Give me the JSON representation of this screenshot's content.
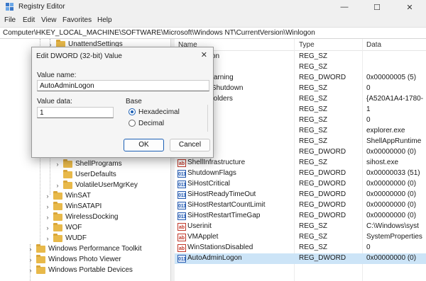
{
  "window": {
    "title": "Registry Editor",
    "minimize_glyph": "—",
    "maximize_glyph": "☐",
    "close_glyph": "✕"
  },
  "menu": [
    "File",
    "Edit",
    "View",
    "Favorites",
    "Help"
  ],
  "address": "Computer\\HKEY_LOCAL_MACHINE\\SOFTWARE\\Microsoft\\Windows NT\\CurrentVersion\\Winlogon",
  "tree": {
    "items": [
      {
        "label": "UnattendSettings"
      },
      {
        "label": "ShellPrograms"
      },
      {
        "label": "UserDefaults"
      },
      {
        "label": "VolatileUserMgrKey"
      },
      {
        "label": "WinSAT"
      },
      {
        "label": "WinSATAPI"
      },
      {
        "label": "WirelessDocking"
      },
      {
        "label": "WOF"
      },
      {
        "label": "WUDF"
      },
      {
        "label": "Windows Performance Toolkit"
      },
      {
        "label": "Windows Photo Viewer"
      },
      {
        "label": "Windows Portable Devices"
      }
    ]
  },
  "list": {
    "columns": {
      "name": "Name",
      "type": "Type",
      "data": "Data"
    },
    "rows": [
      {
        "name": "ceCaption",
        "type": "REG_SZ",
        "data": "",
        "kind": "sz"
      },
      {
        "name": "ceText",
        "type": "REG_SZ",
        "data": "",
        "kind": "sz"
      },
      {
        "name": "ExpiryWarning",
        "type": "REG_DWORD",
        "data": "0x00000005 (5)",
        "kind": "dw"
      },
      {
        "name": "wnAfterShutdown",
        "type": "REG_SZ",
        "data": "0",
        "kind": "sz"
      },
      {
        "name": "KnownFolders",
        "type": "REG_SZ",
        "data": "{A520A1A4-1780-",
        "kind": "sz"
      },
      {
        "name": "otOk",
        "type": "REG_SZ",
        "data": "1",
        "kind": "sz"
      },
      {
        "name": "option",
        "type": "REG_SZ",
        "data": "0",
        "kind": "sz"
      },
      {
        "name": "",
        "type": "REG_SZ",
        "data": "explorer.exe",
        "kind": "sz"
      },
      {
        "name": "Runtime",
        "type": "REG_SZ",
        "data": "ShellAppRuntime",
        "kind": "sz"
      },
      {
        "name": "al",
        "type": "REG_DWORD",
        "data": "0x00000000 (0)",
        "kind": "dw"
      },
      {
        "name": "ShellInfrastructure",
        "type": "REG_SZ",
        "data": "sihost.exe",
        "kind": "sz"
      },
      {
        "name": "ShutdownFlags",
        "type": "REG_DWORD",
        "data": "0x00000033 (51)",
        "kind": "dw"
      },
      {
        "name": "SiHostCritical",
        "type": "REG_DWORD",
        "data": "0x00000000 (0)",
        "kind": "dw"
      },
      {
        "name": "SiHostReadyTimeOut",
        "type": "REG_DWORD",
        "data": "0x00000000 (0)",
        "kind": "dw"
      },
      {
        "name": "SiHostRestartCountLimit",
        "type": "REG_DWORD",
        "data": "0x00000000 (0)",
        "kind": "dw"
      },
      {
        "name": "SiHostRestartTimeGap",
        "type": "REG_DWORD",
        "data": "0x00000000 (0)",
        "kind": "dw"
      },
      {
        "name": "Userinit",
        "type": "REG_SZ",
        "data": "C:\\Windows\\syst",
        "kind": "sz"
      },
      {
        "name": "VMApplet",
        "type": "REG_SZ",
        "data": "SystemProperties",
        "kind": "sz"
      },
      {
        "name": "WinStationsDisabled",
        "type": "REG_SZ",
        "data": "0",
        "kind": "sz"
      },
      {
        "name": "AutoAdminLogon",
        "type": "REG_DWORD",
        "data": "0x00000000 (0)",
        "kind": "dw"
      }
    ]
  },
  "dialog": {
    "title": "Edit DWORD (32-bit) Value",
    "close_glyph": "✕",
    "value_name_label": "Value name:",
    "value_name": "AutoAdminLogon",
    "value_data_label": "Value data:",
    "value_data": "1",
    "base_label": "Base",
    "hex_label": "Hexadecimal",
    "dec_label": "Decimal",
    "selected_base": "hex",
    "ok_label": "OK",
    "cancel_label": "Cancel"
  },
  "icons": {
    "sz_glyph": "ab",
    "dw_glyph": "011"
  },
  "colors": {
    "selection": "#cce4f7",
    "accent": "#1b5fb5",
    "folder": "#e8b94a"
  }
}
